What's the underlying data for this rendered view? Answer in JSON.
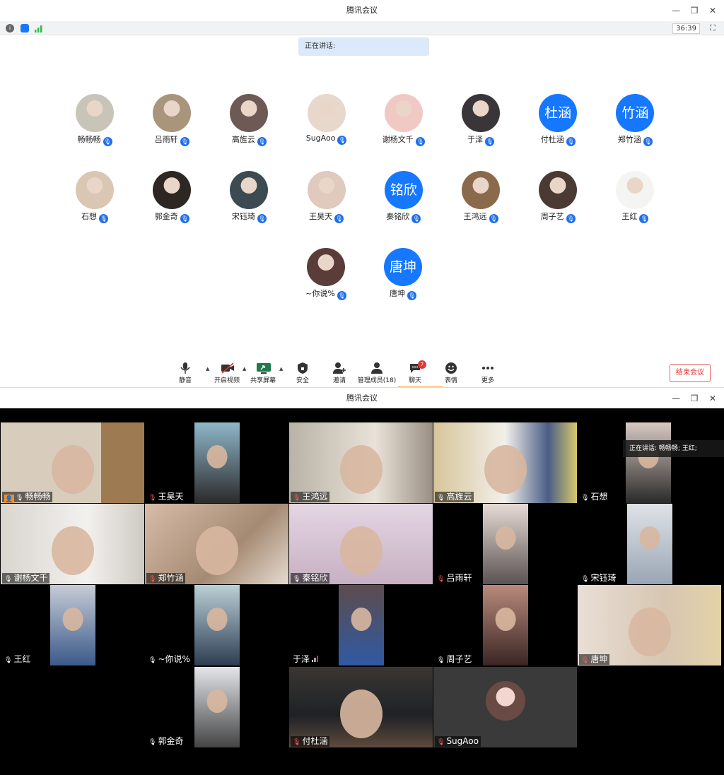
{
  "top_window": {
    "title": "腾讯会议",
    "timer": "36:39",
    "speaking_label": "正在讲话:",
    "participants": [
      {
        "name": "畅畅畅",
        "avatar": "photo"
      },
      {
        "name": "吕雨轩",
        "avatar": "photo"
      },
      {
        "name": "高旌云",
        "avatar": "photo"
      },
      {
        "name": "SugAoo",
        "avatar": "photo"
      },
      {
        "name": "谢杨文千",
        "avatar": "photo"
      },
      {
        "name": "于泽",
        "avatar": "photo"
      },
      {
        "name": "付杜涵",
        "avatar": "text",
        "avatar_text": "杜涵"
      },
      {
        "name": "郑竹涵",
        "avatar": "text",
        "avatar_text": "竹涵"
      },
      {
        "name": "石想",
        "avatar": "photo"
      },
      {
        "name": "郭金奇",
        "avatar": "photo"
      },
      {
        "name": "宋钰琦",
        "avatar": "photo"
      },
      {
        "name": "王昊天",
        "avatar": "photo"
      },
      {
        "name": "秦铭欣",
        "avatar": "text",
        "avatar_text": "铭欣"
      },
      {
        "name": "王鸿远",
        "avatar": "photo"
      },
      {
        "name": "周子艺",
        "avatar": "photo"
      },
      {
        "name": "王红",
        "avatar": "photo"
      },
      {
        "name": "~你说%",
        "avatar": "photo"
      },
      {
        "name": "唐坤",
        "avatar": "text",
        "avatar_text": "唐坤"
      }
    ],
    "toolbar": {
      "mute": "静音",
      "video": "开启视频",
      "share": "共享屏幕",
      "security": "安全",
      "invite": "邀请",
      "members": "管理成员(18)",
      "chat": "聊天",
      "chat_badge": "7",
      "reactions": "表情",
      "more": "更多"
    },
    "end_button": "结束会议"
  },
  "bottom_window": {
    "title": "腾讯会议",
    "speaking_overlay": "正在讲话: 畅畅畅; 王红;",
    "tiles": [
      {
        "name": "畅畅畅",
        "mic": "host"
      },
      {
        "name": "王昊天",
        "mic": "muted"
      },
      {
        "name": "王鸿远",
        "mic": "muted"
      },
      {
        "name": "高旌云",
        "mic": "on"
      },
      {
        "name": "石想",
        "mic": "on"
      },
      {
        "name": "谢杨文千",
        "mic": "on"
      },
      {
        "name": "郑竹涵",
        "mic": "muted"
      },
      {
        "name": "秦铭欣",
        "mic": "on"
      },
      {
        "name": "吕雨轩",
        "mic": "muted"
      },
      {
        "name": "宋钰琦",
        "mic": "on"
      },
      {
        "name": "王红",
        "mic": "on"
      },
      {
        "name": "~你说%",
        "mic": "on"
      },
      {
        "name": "于泽",
        "mic": "signal"
      },
      {
        "name": "周子艺",
        "mic": "on"
      },
      {
        "name": "唐坤",
        "mic": "muted"
      },
      {
        "name": "郭金奇",
        "mic": "on"
      },
      {
        "name": "付杜涵",
        "mic": "muted"
      },
      {
        "name": "SugAoo",
        "mic": "muted"
      }
    ]
  },
  "colors": {
    "accent": "#1677ff",
    "end": "#e03131",
    "active_tile": "#3fb950"
  },
  "icons": [
    "info-icon",
    "shield-icon",
    "signal-icon",
    "fullscreen-icon",
    "minimize-icon",
    "restore-icon",
    "close-icon",
    "mic-icon",
    "camera-off-icon",
    "share-screen-icon",
    "security-icon",
    "invite-icon",
    "members-icon",
    "chat-icon",
    "emoji-icon",
    "more-icon"
  ]
}
